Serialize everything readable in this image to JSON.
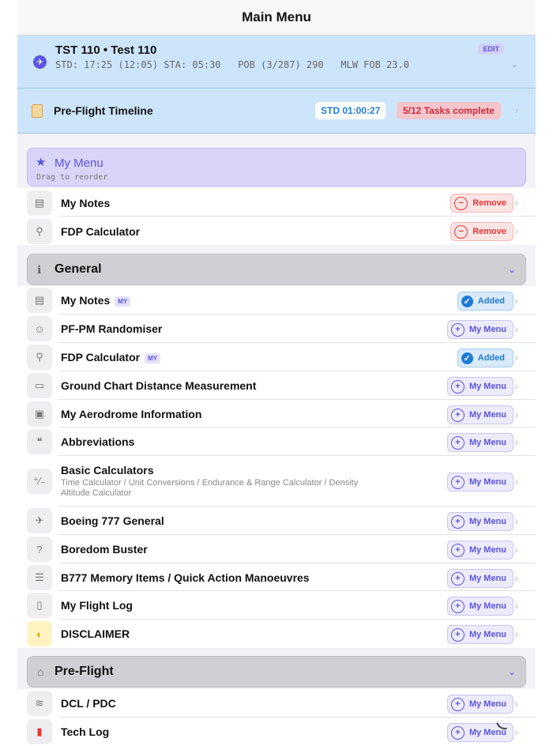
{
  "nav": {
    "title": "Main Menu"
  },
  "flight": {
    "title": "TST 110 • Test 110",
    "std": "STD: 17:25 (12:05) STA: 05:30",
    "pob": "POB (3/287) 290",
    "mlw": "MLW FOB 23.0",
    "edit_label": "EDIT"
  },
  "timeline": {
    "label": "Pre-Flight Timeline",
    "std_countdown": "STD 01:00:27",
    "tasks": "5/12  Tasks complete"
  },
  "my_menu": {
    "title": "My Menu",
    "subtitle": "Drag to reorder",
    "remove_label": "Remove",
    "items": [
      {
        "label": "My Notes",
        "icon": "notes-icon"
      },
      {
        "label": "FDP Calculator",
        "icon": "person-clock-icon"
      }
    ]
  },
  "general": {
    "title": "General",
    "added_label": "Added",
    "mymenu_label": "My Menu",
    "my_badge": "MY",
    "items": [
      {
        "label": "My Notes",
        "state": "added",
        "badge": "MY"
      },
      {
        "label": "PF-PM Randomiser",
        "state": "mymenu"
      },
      {
        "label": "FDP Calculator",
        "state": "added",
        "badge": "MY"
      },
      {
        "label": "Ground Chart Distance Measurement",
        "state": "mymenu"
      },
      {
        "label": "My Aerodrome Information",
        "state": "mymenu"
      },
      {
        "label": "Abbreviations",
        "state": "mymenu"
      },
      {
        "label": "Basic Calculators",
        "sub": "Time Calculator / Unit Conversions / Endurance & Range Calculator / Density Altitude Calculator",
        "state": "mymenu"
      },
      {
        "label": "Boeing 777 General",
        "state": "mymenu"
      },
      {
        "label": "Boredom Buster",
        "state": "mymenu"
      },
      {
        "label": "B777 Memory Items / Quick Action Manoeuvres",
        "state": "mymenu"
      },
      {
        "label": "My Flight Log",
        "state": "mymenu"
      },
      {
        "label": "DISCLAIMER",
        "state": "mymenu"
      }
    ]
  },
  "preflight": {
    "title": "Pre-Flight",
    "items": [
      {
        "label": "DCL / PDC",
        "state": "mymenu"
      },
      {
        "label": "Tech Log",
        "state": "mymenu"
      }
    ]
  }
}
